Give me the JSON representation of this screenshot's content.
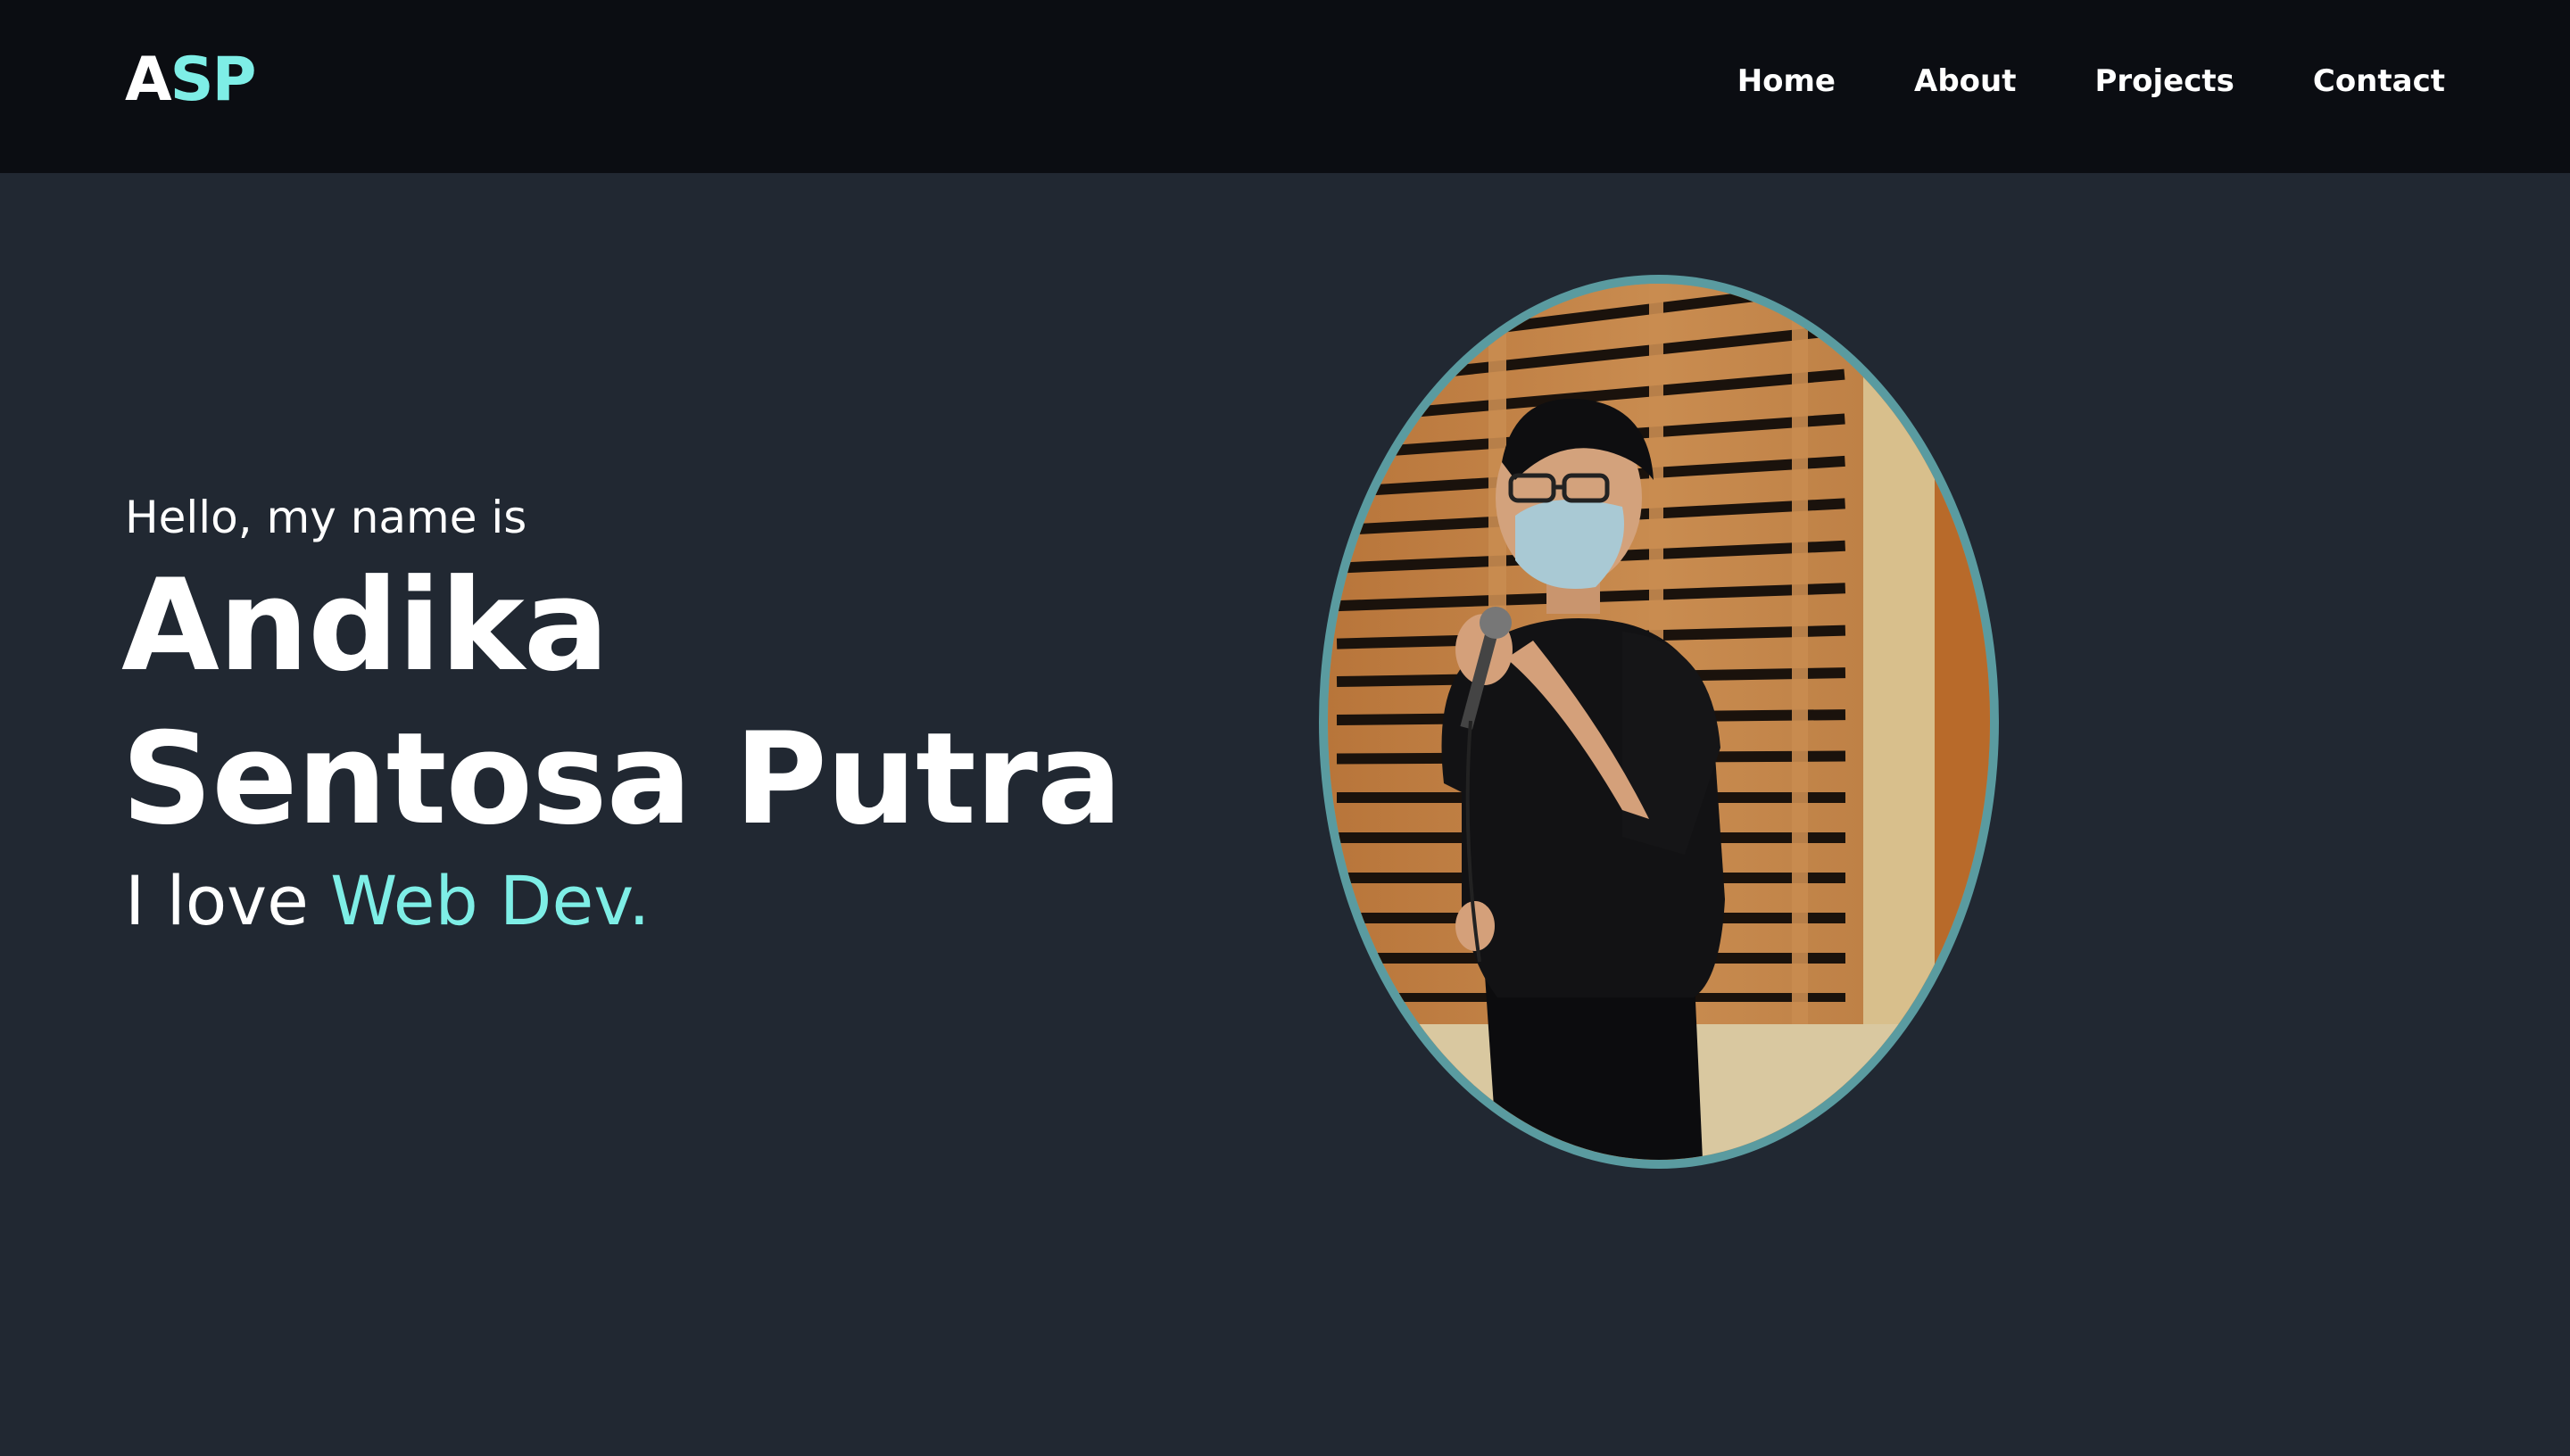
{
  "brand": {
    "logo_first": "A",
    "logo_rest": "SP"
  },
  "nav": {
    "items": [
      {
        "label": "Home"
      },
      {
        "label": "About"
      },
      {
        "label": "Projects"
      },
      {
        "label": "Contact"
      }
    ]
  },
  "hero": {
    "greeting": "Hello, my name is",
    "name_line1": "Andika",
    "name_line2": "Sentosa Putra",
    "tagline_prefix": "I love ",
    "tagline_accent": "Web Dev."
  },
  "colors": {
    "background": "#212832",
    "navbar": "#0b0d12",
    "accent": "#7eeee6",
    "portrait_border": "#5a9ba0",
    "text": "#ffffff"
  },
  "portrait": {
    "subject": "person-speaking-with-microphone-photo"
  }
}
